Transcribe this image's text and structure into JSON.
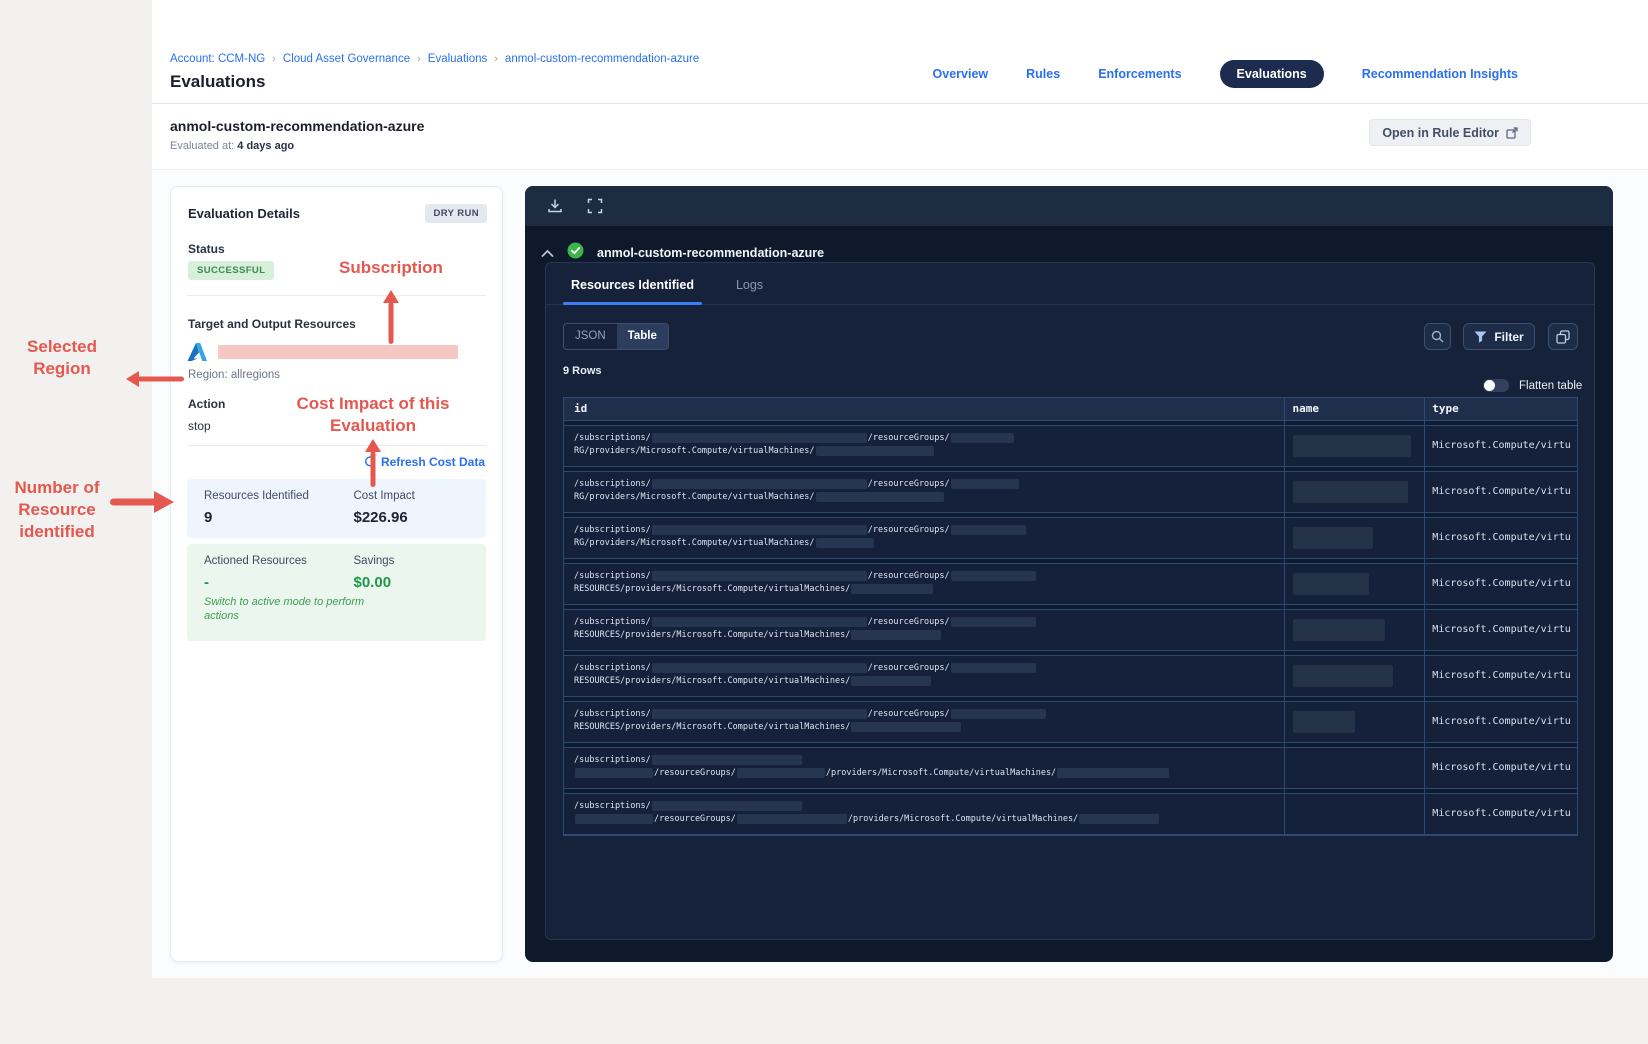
{
  "colors": {
    "accent_blue": "#2970ef",
    "annotation_red": "#e4584f",
    "success_green": "#3c8a50",
    "savings_green": "#1f9748",
    "panel_navy": "#0e1a2c",
    "pill_navy": "#1c2b4e",
    "tab_underline": "#3d7df5",
    "redaction_pink": "#f4c9c4"
  },
  "header": {
    "breadcrumb": [
      "Account: CCM-NG",
      "Cloud Asset Governance",
      "Evaluations",
      "anmol-custom-recommendation-azure"
    ],
    "page_title": "Evaluations",
    "nav": [
      {
        "label": "Overview",
        "active": false
      },
      {
        "label": "Rules",
        "active": false
      },
      {
        "label": "Enforcements",
        "active": false
      },
      {
        "label": "Evaluations",
        "active": true
      },
      {
        "label": "Recommendation Insights",
        "active": false
      }
    ]
  },
  "subheader": {
    "title": "anmol-custom-recommendation-azure",
    "evaluated_label": "Evaluated at:",
    "evaluated_value": "4 days ago",
    "open_rule_editor": "Open in Rule Editor"
  },
  "annotations": {
    "subscription": "Subscription",
    "selected_region": "Selected Region",
    "cost_impact": "Cost Impact of this Evaluation",
    "resources_count": "Number of Resource identified"
  },
  "details": {
    "title": "Evaluation Details",
    "dry_run": "DRY RUN",
    "status_label": "Status",
    "status_value": "SUCCESSFUL",
    "target_label": "Target and Output Resources",
    "cloud_icon": "azure-icon",
    "region": "Region: allregions",
    "action_label": "Action",
    "action_value": "stop",
    "refresh_link": "Refresh Cost Data",
    "metrics": {
      "resources_label": "Resources Identified",
      "resources_value": "9",
      "cost_label": "Cost Impact",
      "cost_value": "$226.96"
    },
    "actioned": {
      "label": "Actioned Resources",
      "value": "-",
      "savings_label": "Savings",
      "savings_value": "$0.00",
      "note": "Switch to active mode to perform actions"
    }
  },
  "results": {
    "title": "anmol-custom-recommendation-azure",
    "tabs": [
      {
        "label": "Resources Identified",
        "active": true
      },
      {
        "label": "Logs",
        "active": false
      }
    ],
    "view_modes": [
      {
        "label": "JSON",
        "active": false
      },
      {
        "label": "Table",
        "active": true
      }
    ],
    "filter_label": "Filter",
    "rows_count": "9 Rows",
    "flatten_label": "Flatten table",
    "table": {
      "columns": [
        "id",
        "name",
        "type"
      ],
      "rows": [
        {
          "line1": [
            {
              "t": "/subscriptions/"
            },
            {
              "r": 215
            },
            {
              "t": "/resourceGroups/"
            },
            {
              "r": 63
            }
          ],
          "line2": [
            {
              "t": "RG/providers/Microsoft.Compute/virtualMachines/"
            },
            {
              "r": 118
            }
          ],
          "name_redacted_width": 118,
          "type": "Microsoft.Compute/virtu"
        },
        {
          "line1": [
            {
              "t": "/subscriptions/"
            },
            {
              "r": 215
            },
            {
              "t": "/resourceGroups/"
            },
            {
              "r": 68
            }
          ],
          "line2": [
            {
              "t": "RG/providers/Microsoft.Compute/virtualMachines/"
            },
            {
              "r": 128
            }
          ],
          "name_redacted_width": 115,
          "type": "Microsoft.Compute/virtu"
        },
        {
          "line1": [
            {
              "t": "/subscriptions/"
            },
            {
              "r": 215
            },
            {
              "t": "/resourceGroups/"
            },
            {
              "r": 75
            }
          ],
          "line2": [
            {
              "t": "RG/providers/Microsoft.Compute/virtualMachines/"
            },
            {
              "r": 58
            }
          ],
          "name_redacted_width": 80,
          "type": "Microsoft.Compute/virtu"
        },
        {
          "line1": [
            {
              "t": "/subscriptions/"
            },
            {
              "r": 215
            },
            {
              "t": "/resourceGroups/"
            },
            {
              "r": 85
            }
          ],
          "line2": [
            {
              "t": "RESOURCES/providers/Microsoft.Compute/virtualMachines/"
            },
            {
              "r": 82
            }
          ],
          "name_redacted_width": 76,
          "type": "Microsoft.Compute/virtu"
        },
        {
          "line1": [
            {
              "t": "/subscriptions/"
            },
            {
              "r": 215
            },
            {
              "t": "/resourceGroups/"
            },
            {
              "r": 85
            }
          ],
          "line2": [
            {
              "t": "RESOURCES/providers/Microsoft.Compute/virtualMachines/"
            },
            {
              "r": 90
            }
          ],
          "name_redacted_width": 92,
          "type": "Microsoft.Compute/virtu"
        },
        {
          "line1": [
            {
              "t": "/subscriptions/"
            },
            {
              "r": 215
            },
            {
              "t": "/resourceGroups/"
            },
            {
              "r": 85
            }
          ],
          "line2": [
            {
              "t": "RESOURCES/providers/Microsoft.Compute/virtualMachines/"
            },
            {
              "r": 80
            }
          ],
          "name_redacted_width": 100,
          "type": "Microsoft.Compute/virtu"
        },
        {
          "line1": [
            {
              "t": "/subscriptions/"
            },
            {
              "r": 215
            },
            {
              "t": "/resourceGroups/"
            },
            {
              "r": 95
            }
          ],
          "line2": [
            {
              "t": "RESOURCES/providers/Microsoft.Compute/virtualMachines/"
            },
            {
              "r": 110
            }
          ],
          "name_redacted_width": 62,
          "type": "Microsoft.Compute/virtu"
        },
        {
          "line1": [
            {
              "t": "/subscriptions/"
            },
            {
              "r": 150
            }
          ],
          "line2": [
            {
              "r": 78
            },
            {
              "t": "/resourceGroups/"
            },
            {
              "r": 88
            },
            {
              "t": "/providers/Microsoft.Compute/virtualMachines/"
            },
            {
              "r": 112
            }
          ],
          "name_redacted_width": 0,
          "type": "Microsoft.Compute/virtu"
        },
        {
          "line1": [
            {
              "t": "/subscriptions/"
            },
            {
              "r": 150
            }
          ],
          "line2": [
            {
              "r": 78
            },
            {
              "t": "/resourceGroups/"
            },
            {
              "r": 110
            },
            {
              "t": "/providers/Microsoft.Compute/virtualMachines/"
            },
            {
              "r": 80
            }
          ],
          "name_redacted_width": 0,
          "type": "Microsoft.Compute/virtu"
        }
      ]
    }
  }
}
